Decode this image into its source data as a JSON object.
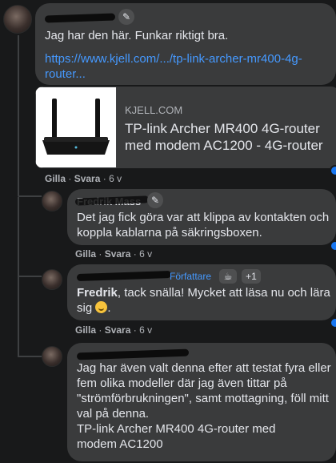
{
  "comment1": {
    "text": "Jag har den här. Funkar riktigt bra.",
    "link": "https://www.kjell.com/.../tp-link-archer-mr400-4g-router...",
    "preview": {
      "domain": "KJELL.COM",
      "title": "TP-link Archer MR400 4G-router med modem AC1200 - 4G-router"
    },
    "actions": {
      "like": "Gilla",
      "reply": "Svara",
      "time": "6 v"
    }
  },
  "comment2": {
    "author": "Fredrik Mass",
    "text": "Det jag fick göra var att klippa av kontakten och koppla kablarna på säkringsboxen.",
    "actions": {
      "like": "Gilla",
      "reply": "Svara",
      "time": "6 v"
    }
  },
  "comment3": {
    "tag": "Författare",
    "badge_count": "+1",
    "mention": "Fredrik",
    "text": ", tack snälla! Mycket att läsa nu och lära sig",
    "actions": {
      "like": "Gilla",
      "reply": "Svara",
      "time": "6 v"
    }
  },
  "comment4": {
    "text": "Jag har även valt denna efter att testat fyra eller fem olika modeller där jag även tittar på \"strömförbrukningen\", samt mottagning, föll mitt val på denna.",
    "text2": "TP-link Archer MR400 4G-router med modem AC1200"
  },
  "icons": [
    "pencil-icon",
    "coffee-icon",
    "smile-emoji",
    "reaction-icon",
    "router-image"
  ],
  "colors": {
    "background": "#18191a",
    "bubble": "#3a3b3c",
    "link": "#4599ff",
    "meta": "#b0b3b8",
    "reaction": "#1877f2"
  }
}
